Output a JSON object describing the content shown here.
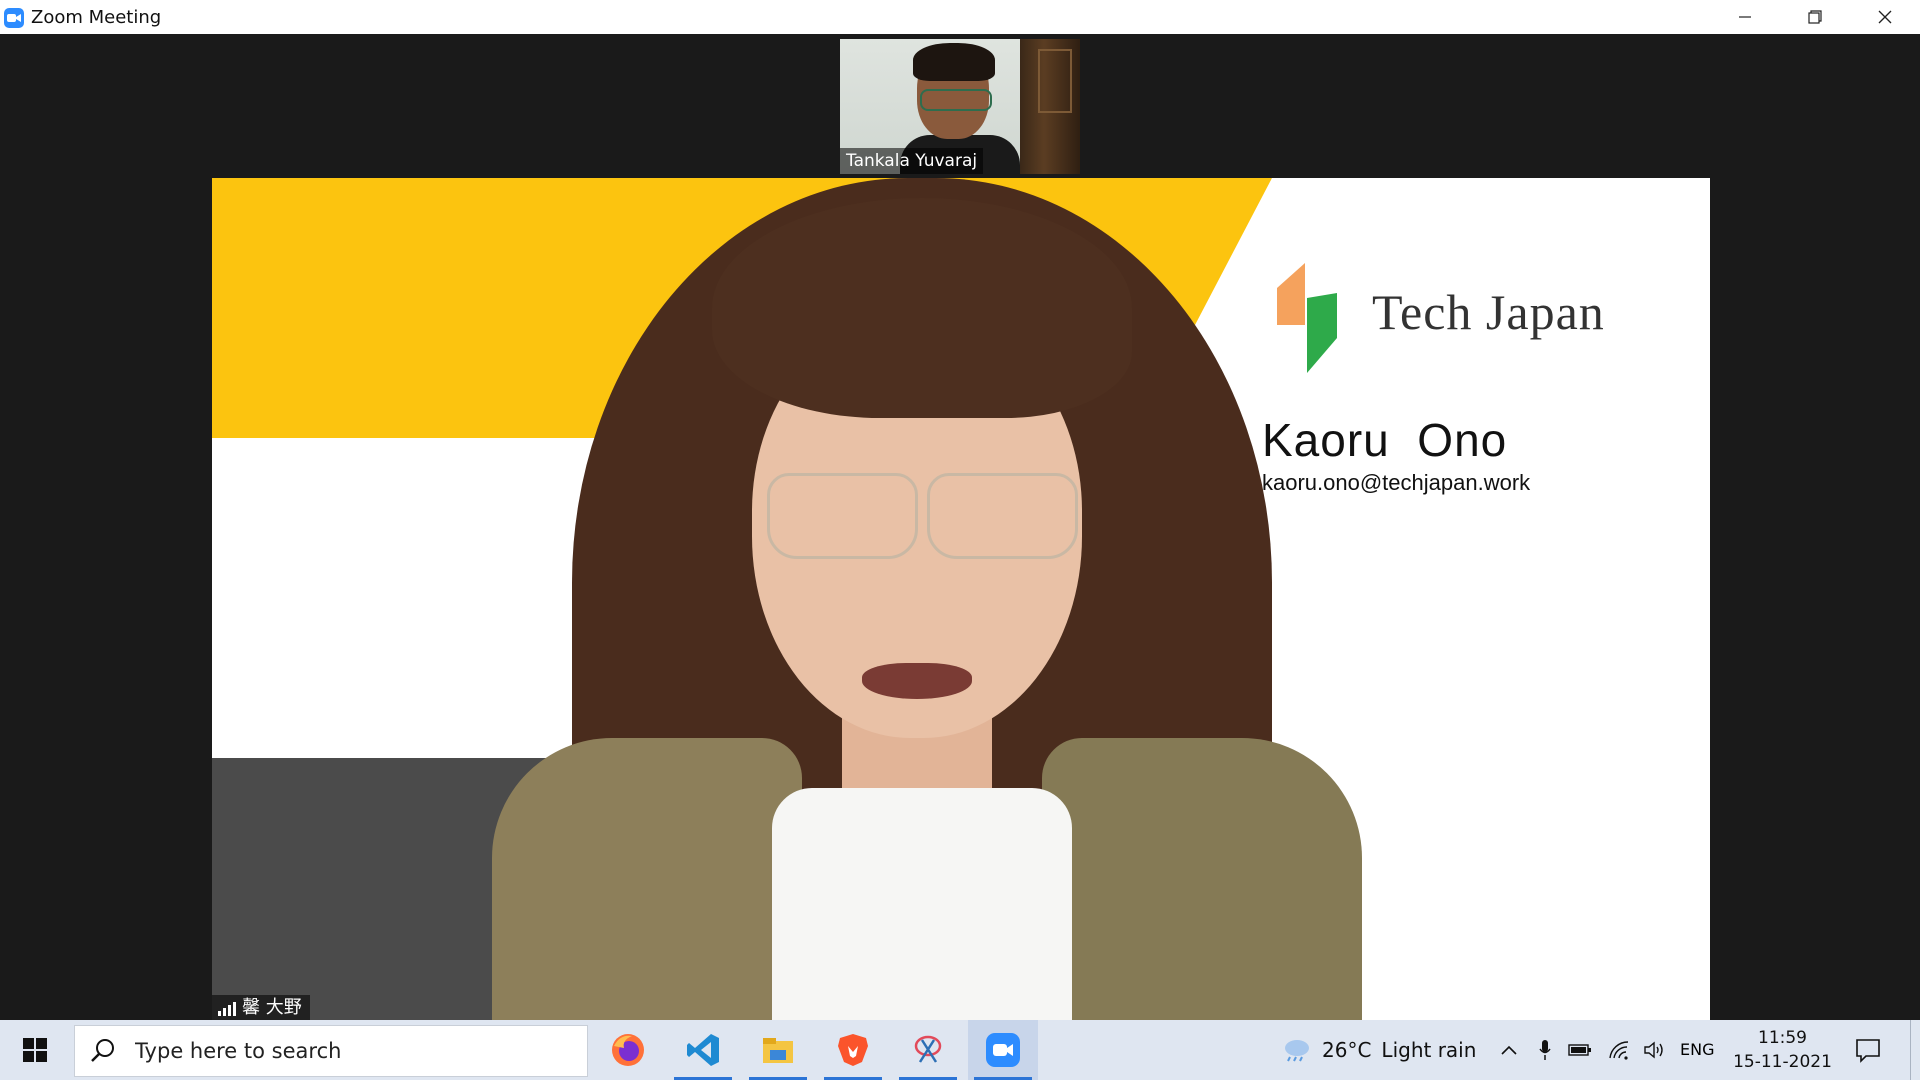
{
  "window": {
    "title": "Zoom Meeting",
    "minimize_label": "Minimize",
    "maximize_label": "Restore",
    "close_label": "Close"
  },
  "meeting": {
    "thumbnail_participant": {
      "name": "Tankala Yuvaraj"
    },
    "active_speaker": {
      "name": "馨 大野",
      "background": {
        "brand": "Tech Japan",
        "person_name": "Kaoru  Ono",
        "person_email": "kaoru.ono@techjapan.work",
        "colors": {
          "yellow": "#fcc40f",
          "gray": "#4b4b4b",
          "logo_orange": "#f5a25d",
          "logo_green": "#2eaa4a"
        }
      }
    }
  },
  "taskbar": {
    "search_placeholder": "Type here to search",
    "pinned_apps": [
      {
        "name": "firefox-icon"
      },
      {
        "name": "vscode-icon"
      },
      {
        "name": "file-explorer-icon"
      },
      {
        "name": "brave-icon"
      },
      {
        "name": "snip-tool-icon"
      },
      {
        "name": "zoom-icon",
        "active": true
      }
    ],
    "weather": {
      "temperature": "26°C",
      "condition": "Light rain"
    },
    "language": "ENG",
    "time": "11:59",
    "date": "15-11-2021"
  }
}
